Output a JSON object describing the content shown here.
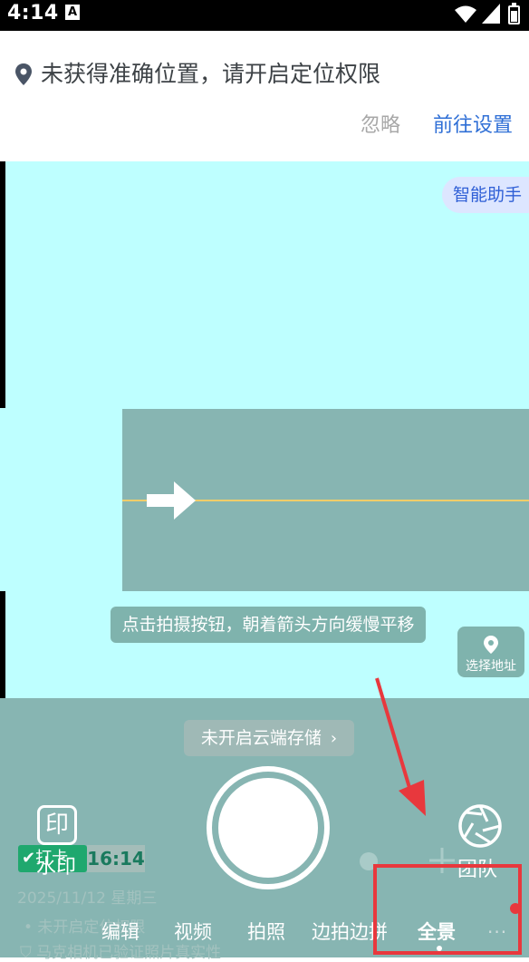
{
  "status_bar": {
    "time": "4:14",
    "notif_icon": "A"
  },
  "location_banner": {
    "icon": "location-pin-icon",
    "message": "未获得准确位置，请开启定位权限",
    "ignore_label": "忽略",
    "settings_label": "前往设置"
  },
  "camera": {
    "assistant_label": "智能助手",
    "panorama_hint": "点击拍摄按钮，朝着箭头方向缓慢平移",
    "select_address_label": "选择地址",
    "cloud_storage_label": "未开启云端存储",
    "cloud_storage_chevron": "›"
  },
  "watermark_overlay": {
    "checkin_label": "✔打卡",
    "time": "16:14",
    "date_line": "2025/11/12  星期三",
    "location_line": "• 未开启定位权限",
    "verify_line": "马克相机已验证照片真实性"
  },
  "controls": {
    "watermark_icon_glyph": "印",
    "watermark_label": "水印",
    "team_label": "团队"
  },
  "modes": {
    "items": [
      "编辑",
      "视频",
      "拍照",
      "边拍边拼",
      "全景"
    ],
    "selected": "全景",
    "more": "···"
  },
  "colors": {
    "viewfinder": "#beffff",
    "panel": "#87b5b2",
    "accent_blue": "#2f6fd6",
    "annotation_red": "#e8383d",
    "checkin_green": "#1aa86b"
  }
}
